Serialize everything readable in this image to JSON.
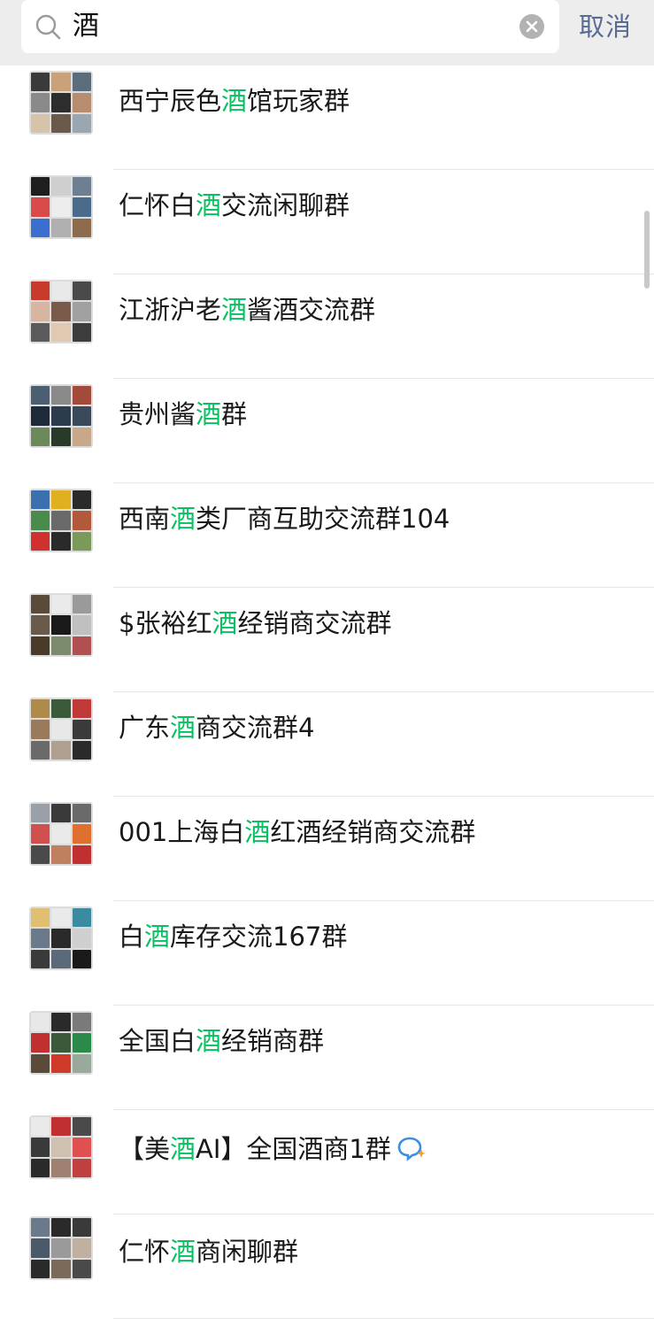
{
  "search": {
    "query": "酒",
    "cancel_label": "取消"
  },
  "colors": {
    "highlight": "#07c160",
    "cancel": "#576b95",
    "topbar": "#ededed"
  },
  "results": [
    {
      "pre": "西宁辰色",
      "hl": "酒",
      "post": "馆玩家群"
    },
    {
      "pre": "仁怀白",
      "hl": "酒",
      "post": "交流闲聊群"
    },
    {
      "pre": "江浙沪老",
      "hl": "酒",
      "post": "酱酒交流群"
    },
    {
      "pre": "贵州酱",
      "hl": "酒",
      "post": "群"
    },
    {
      "pre": "西南",
      "hl": "酒",
      "post": "类厂商互助交流群104"
    },
    {
      "pre": "$张裕红",
      "hl": "酒",
      "post": "经销商交流群"
    },
    {
      "pre": "广东",
      "hl": "酒",
      "post": "商交流群4"
    },
    {
      "pre": "001上海白",
      "hl": "酒",
      "post": "红酒经销商交流群"
    },
    {
      "pre": "白",
      "hl": "酒",
      "post": "库存交流167群"
    },
    {
      "pre": "全国白",
      "hl": "酒",
      "post": "经销商群"
    },
    {
      "pre": "【美",
      "hl": "酒",
      "post": "AI】全国酒商1群"
    },
    {
      "pre": "仁怀",
      "hl": "酒",
      "post": "商闲聊群"
    }
  ],
  "icons": {
    "search": "search-icon",
    "clear": "clear-icon",
    "ai_badge": "ai-chat-icon"
  }
}
